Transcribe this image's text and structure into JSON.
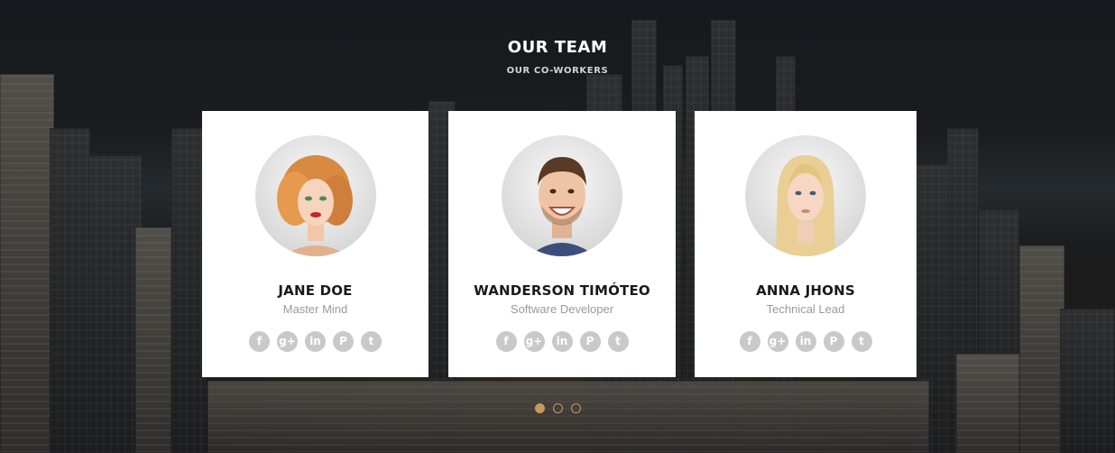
{
  "section": {
    "title": "OUR TEAM",
    "subtitle": "OUR CO-WORKERS"
  },
  "team": [
    {
      "name": "JANE DOE",
      "role": "Master Mind",
      "avatar_icon": "woman-redhead-portrait",
      "socials": [
        "facebook-icon",
        "google-plus-icon",
        "linkedin-icon",
        "pinterest-icon",
        "twitter-icon"
      ]
    },
    {
      "name": "WANDERSON TIMÓTEO",
      "role": "Software Developer",
      "avatar_icon": "man-smiling-portrait",
      "socials": [
        "facebook-icon",
        "google-plus-icon",
        "linkedin-icon",
        "pinterest-icon",
        "twitter-icon"
      ]
    },
    {
      "name": "ANNA JHONS",
      "role": "Technical Lead",
      "avatar_icon": "woman-blonde-portrait",
      "socials": [
        "facebook-icon",
        "google-plus-icon",
        "linkedin-icon",
        "pinterest-icon",
        "twitter-icon"
      ]
    }
  ],
  "social_glyphs": {
    "facebook": "f",
    "google_plus": "g+",
    "linkedin": "in",
    "pinterest": "P",
    "twitter": "t"
  },
  "carousel": {
    "pages": 3,
    "active_page": 1
  },
  "colors": {
    "accent": "#c79b5d",
    "card_bg": "#ffffff",
    "name_text": "#1a1a1a",
    "role_text": "#9a9a9a",
    "social_icon_bg": "#c9c9c9"
  }
}
